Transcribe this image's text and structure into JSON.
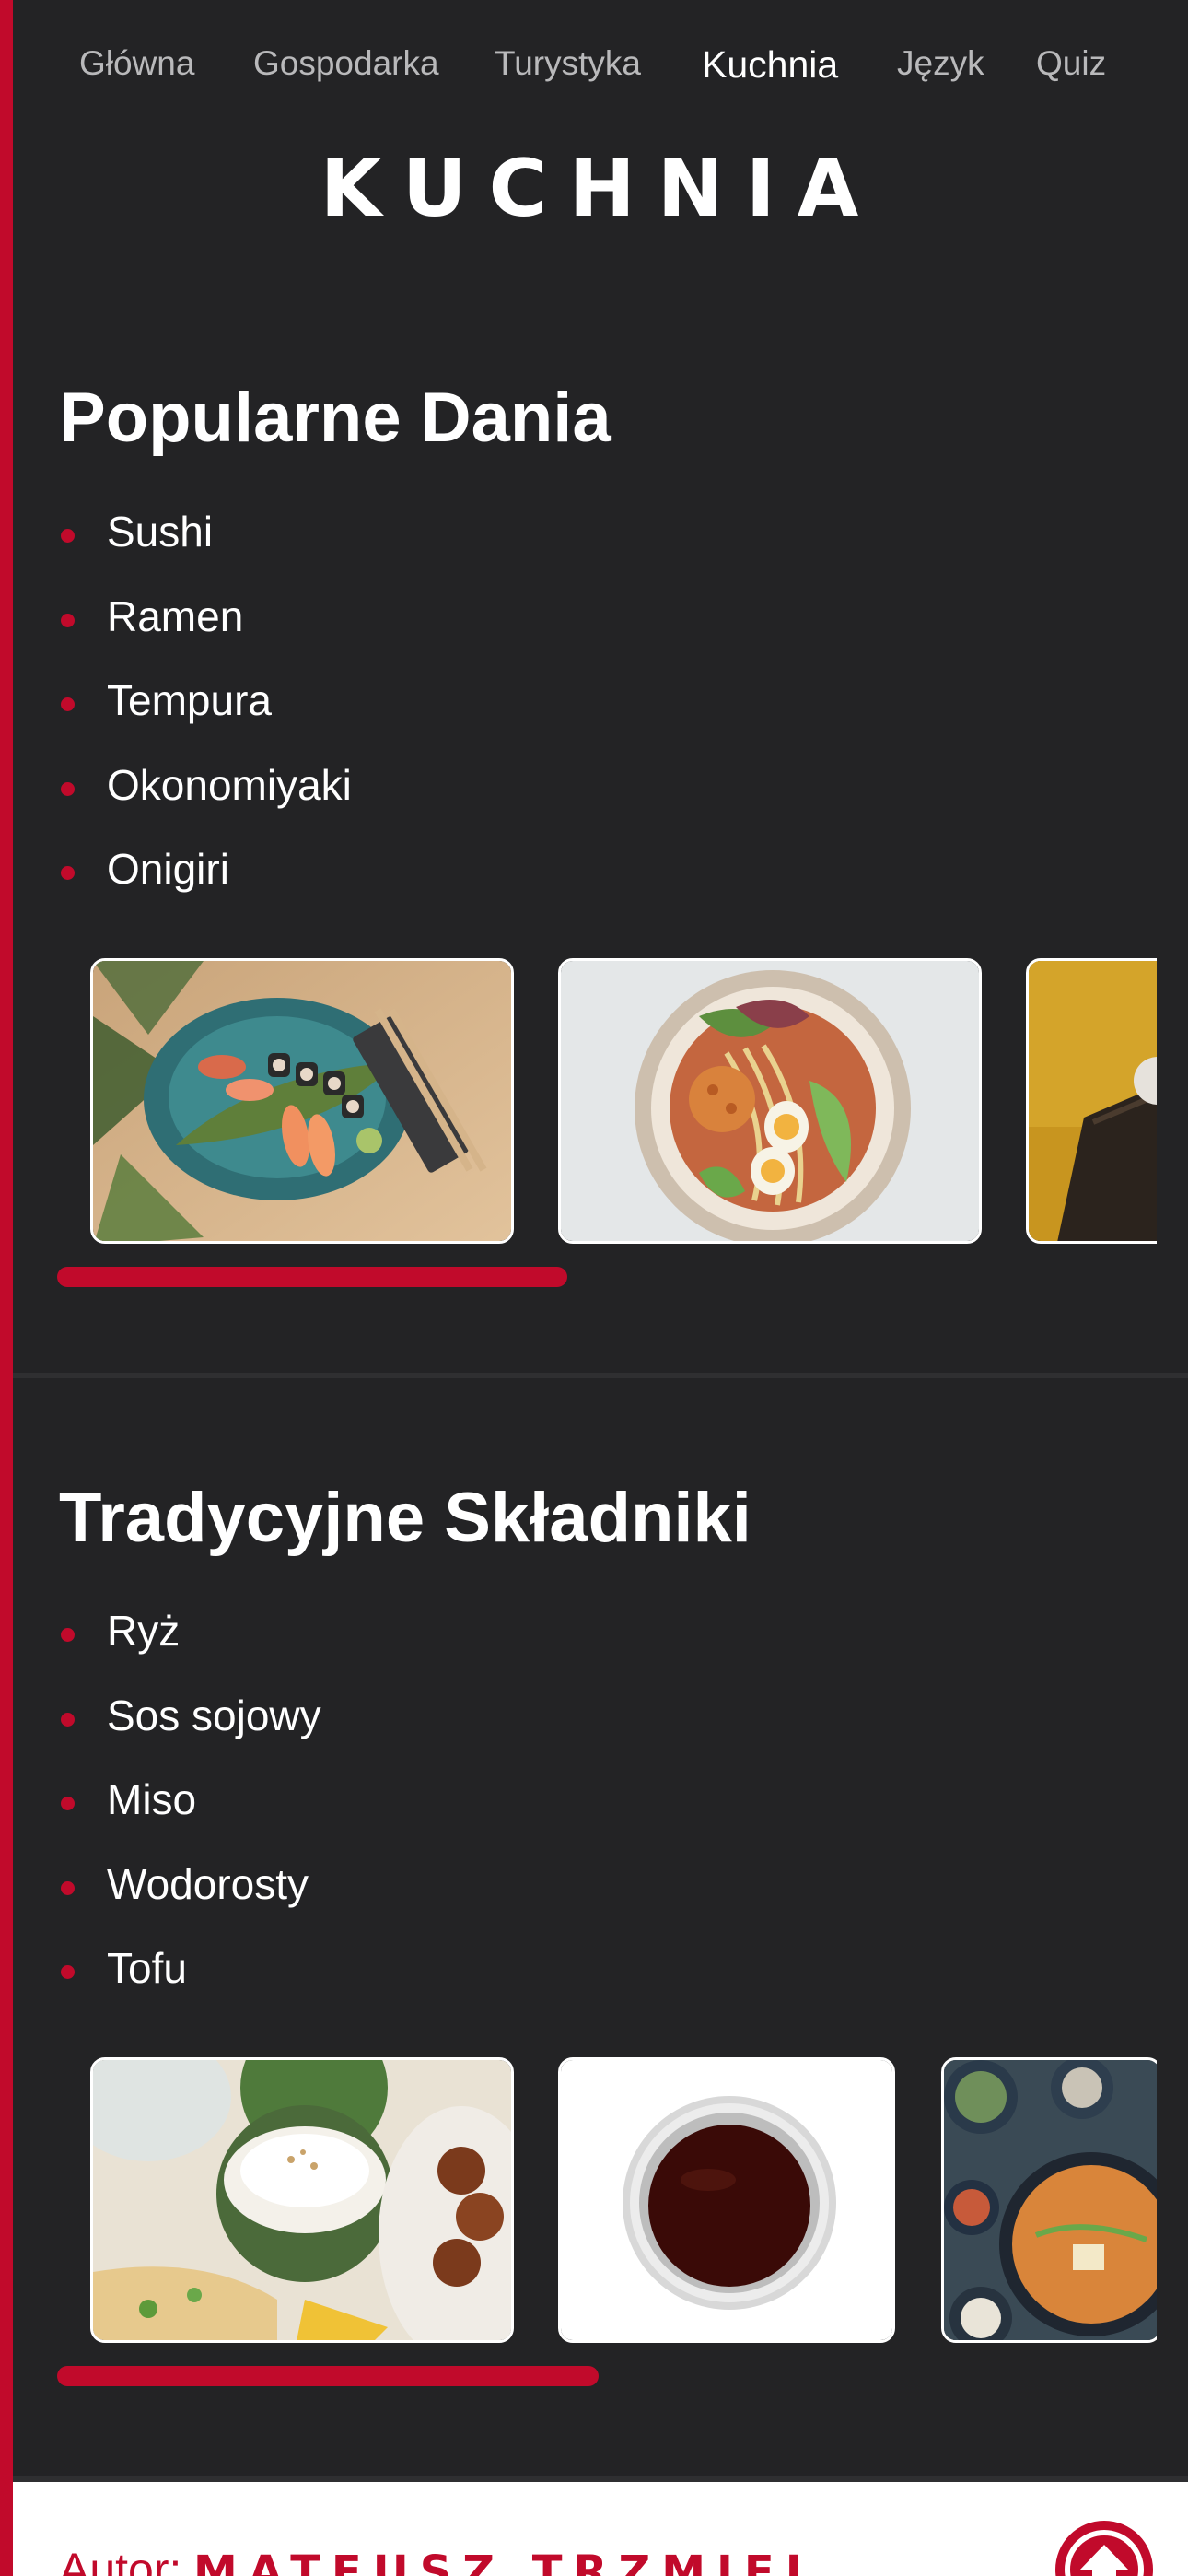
{
  "nav": {
    "items": [
      {
        "label": "Główna",
        "active": false
      },
      {
        "label": "Gospodarka",
        "active": false
      },
      {
        "label": "Turystyka",
        "active": false
      },
      {
        "label": "Kuchnia",
        "active": true
      },
      {
        "label": "Język",
        "active": false
      },
      {
        "label": "Quiz",
        "active": false
      }
    ]
  },
  "logo": "KUCHNIA",
  "sections": [
    {
      "title": "Popularne Dania",
      "items": [
        "Sushi",
        "Ramen",
        "Tempura",
        "Okonomiyaki",
        "Onigiri"
      ],
      "gallery": [
        {
          "icon": "sushi-plate-photo"
        },
        {
          "icon": "ramen-bowl-photo"
        },
        {
          "icon": "tempura-tray-photo"
        }
      ],
      "scroll_position": 0
    },
    {
      "title": "Tradycyjne Składniki",
      "items": [
        "Ryż",
        "Sos sojowy",
        "Miso",
        "Wodorosty",
        "Tofu"
      ],
      "gallery": [
        {
          "icon": "rice-meal-photo"
        },
        {
          "icon": "soy-sauce-photo"
        },
        {
          "icon": "miso-soup-photo"
        }
      ],
      "scroll_position": 0
    }
  ],
  "footer": {
    "author_label": "Autor:",
    "author_name": "MATEUSZ TRZMIEL",
    "scroll_top_icon": "arrow-up-icon"
  },
  "colors": {
    "accent": "#c10a2b",
    "background": "#232325",
    "text": "#ffffff",
    "nav_text": "#b9b9bb"
  }
}
